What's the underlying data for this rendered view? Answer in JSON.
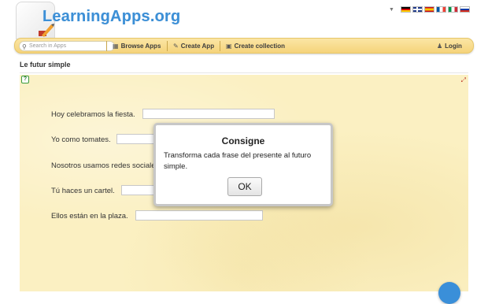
{
  "brand": {
    "name": "LearningApps.org"
  },
  "language_flags": [
    "de-flag",
    "uk-flag",
    "es-flag",
    "fr-flag",
    "it-flag",
    "ru-flag"
  ],
  "nav": {
    "search_placeholder": "Search in Apps",
    "browse": "Browse Apps",
    "create_app": "Create App",
    "create_collection": "Create collection",
    "login": "Login"
  },
  "page": {
    "title": "Le futur simple"
  },
  "exercise": {
    "sentences": [
      "Hoy celebramos la fiesta.",
      "Yo como tomates.",
      "Nosotros usamos redes sociales.",
      "Tú haces un cartel.",
      "Ellos están en la plaza."
    ]
  },
  "modal": {
    "title": "Consigne",
    "text": "Transforma cada frase del presente al futuro simple.",
    "ok_label": "OK"
  },
  "colors": {
    "nav_bg": "#f5d37a",
    "app_bg": "#fbf0c2",
    "brand_blue": "#3c8fd6",
    "fab_blue": "#3a8fd9"
  }
}
